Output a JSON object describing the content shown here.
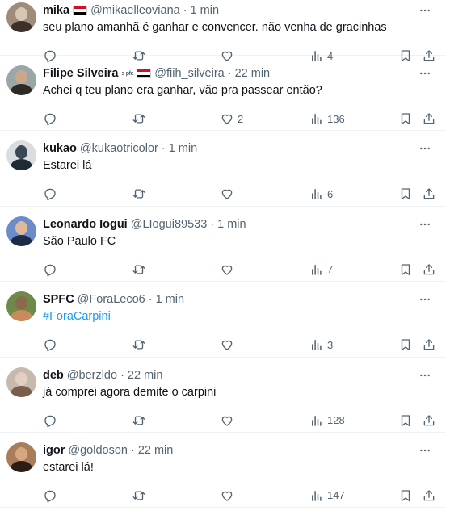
{
  "tweets": [
    {
      "name": "mika",
      "flag": true,
      "handle": "@mikaelleoviana",
      "time": "1 min",
      "text": "seu plano amanhã é ganhar e convencer. não venha de gracinhas",
      "likes": "",
      "views": "4",
      "avatar_colors": [
        "#a08b78",
        "#3d3029",
        "#d8c6b4"
      ]
    },
    {
      "name": "Filipe Silveira",
      "badge": "s pfc",
      "flag": true,
      "handle": "@fiih_silveira",
      "time": "22 min",
      "text": "Achei q teu plano era ganhar, vão pra passear então?",
      "likes": "2",
      "views": "136",
      "avatar_colors": [
        "#9aa7a8",
        "#2e2a26",
        "#c9a88d"
      ]
    },
    {
      "name": "kukao",
      "handle": "@kukaotricolor",
      "time": "1 min",
      "text": "Estarei lá",
      "likes": "",
      "views": "6",
      "avatar_colors": [
        "#d9dde0",
        "#1f2a36",
        "#3b4754"
      ]
    },
    {
      "name": "Leonardo Iogui",
      "handle": "@LIogui89533",
      "time": "1 min",
      "text": "São Paulo FC",
      "likes": "",
      "views": "7",
      "avatar_colors": [
        "#6b8cc9",
        "#1d2b45",
        "#e0b89c"
      ]
    },
    {
      "name": "SPFC",
      "handle": "@ForaLeco6",
      "time": "1 min",
      "text": "#ForaCarpini",
      "text_is_link": true,
      "likes": "",
      "views": "3",
      "avatar_colors": [
        "#6e8a4a",
        "#c98b5c",
        "#8a6a4a"
      ]
    },
    {
      "name": "deb",
      "handle": "@berzldo",
      "time": "22 min",
      "text": "já comprei agora demite o carpini",
      "likes": "",
      "views": "128",
      "avatar_colors": [
        "#c7b9ae",
        "#7a5e4c",
        "#e2cfc2"
      ]
    },
    {
      "name": "igor",
      "handle": "@goldoson",
      "time": "22 min",
      "text": "estarei lá!",
      "likes": "",
      "views": "147",
      "avatar_colors": [
        "#a87d5c",
        "#2b1d14",
        "#d9a77e"
      ]
    }
  ]
}
